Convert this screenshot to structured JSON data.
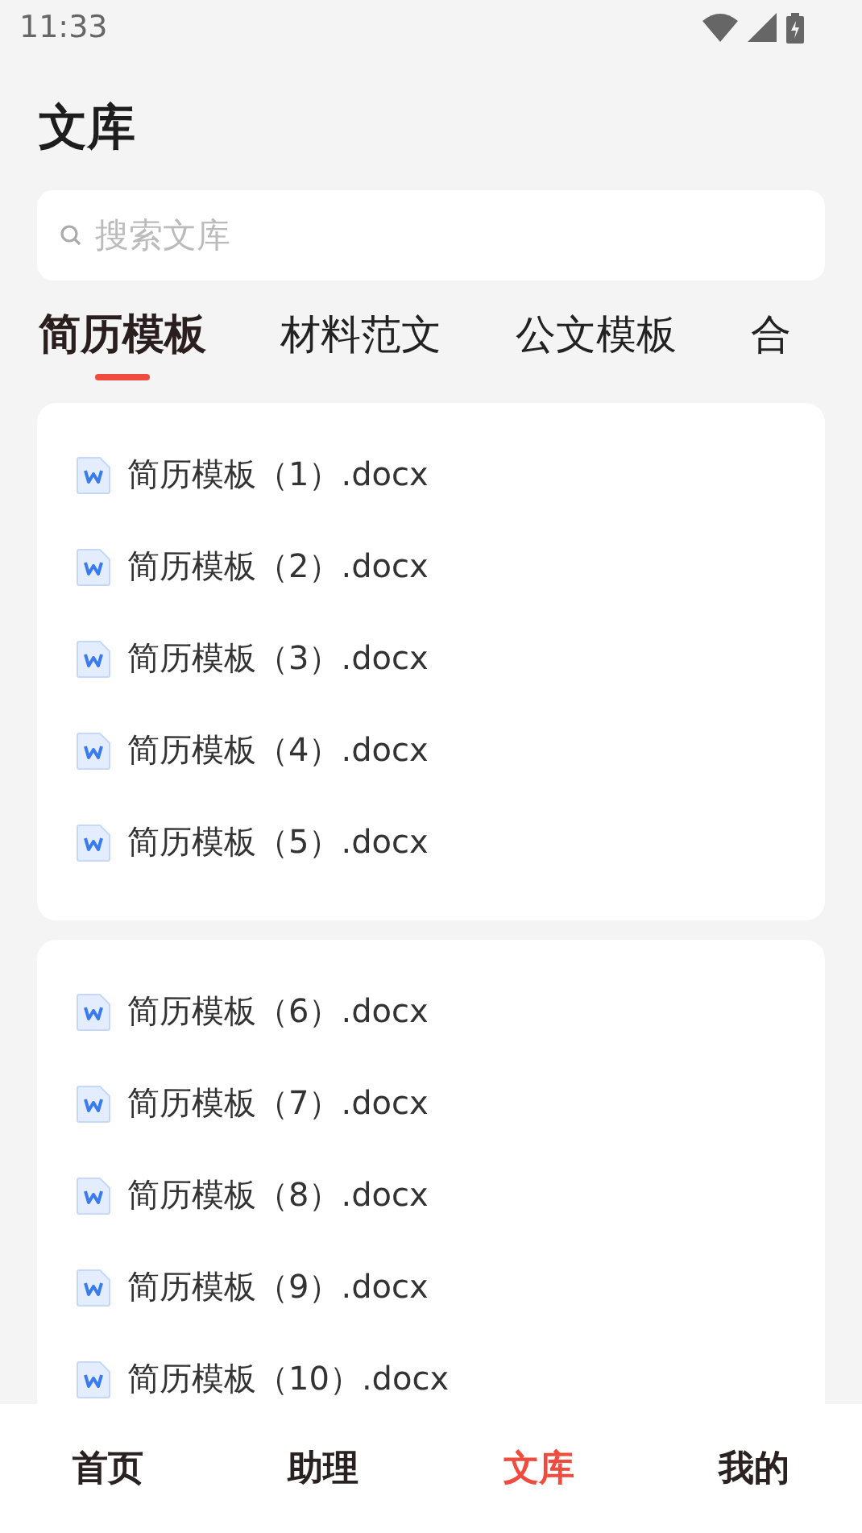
{
  "status_bar": {
    "time": "11:33"
  },
  "page_title": "文库",
  "search": {
    "placeholder": "搜索文库"
  },
  "tabs": [
    {
      "label": "简历模板",
      "selected": true
    },
    {
      "label": "材料范文",
      "selected": false
    },
    {
      "label": "公文模板",
      "selected": false
    },
    {
      "label": "合",
      "selected": false
    }
  ],
  "groups": [
    {
      "files": [
        "简历模板（1）.docx",
        "简历模板（2）.docx",
        "简历模板（3）.docx",
        "简历模板（4）.docx",
        "简历模板（5）.docx"
      ]
    },
    {
      "files": [
        "简历模板（6）.docx",
        "简历模板（7）.docx",
        "简历模板（8）.docx",
        "简历模板（9）.docx",
        "简历模板（10）.docx"
      ]
    }
  ],
  "bottom_nav": [
    {
      "label": "首页",
      "selected": false
    },
    {
      "label": "助理",
      "selected": false
    },
    {
      "label": "文库",
      "selected": true
    },
    {
      "label": "我的",
      "selected": false
    }
  ]
}
